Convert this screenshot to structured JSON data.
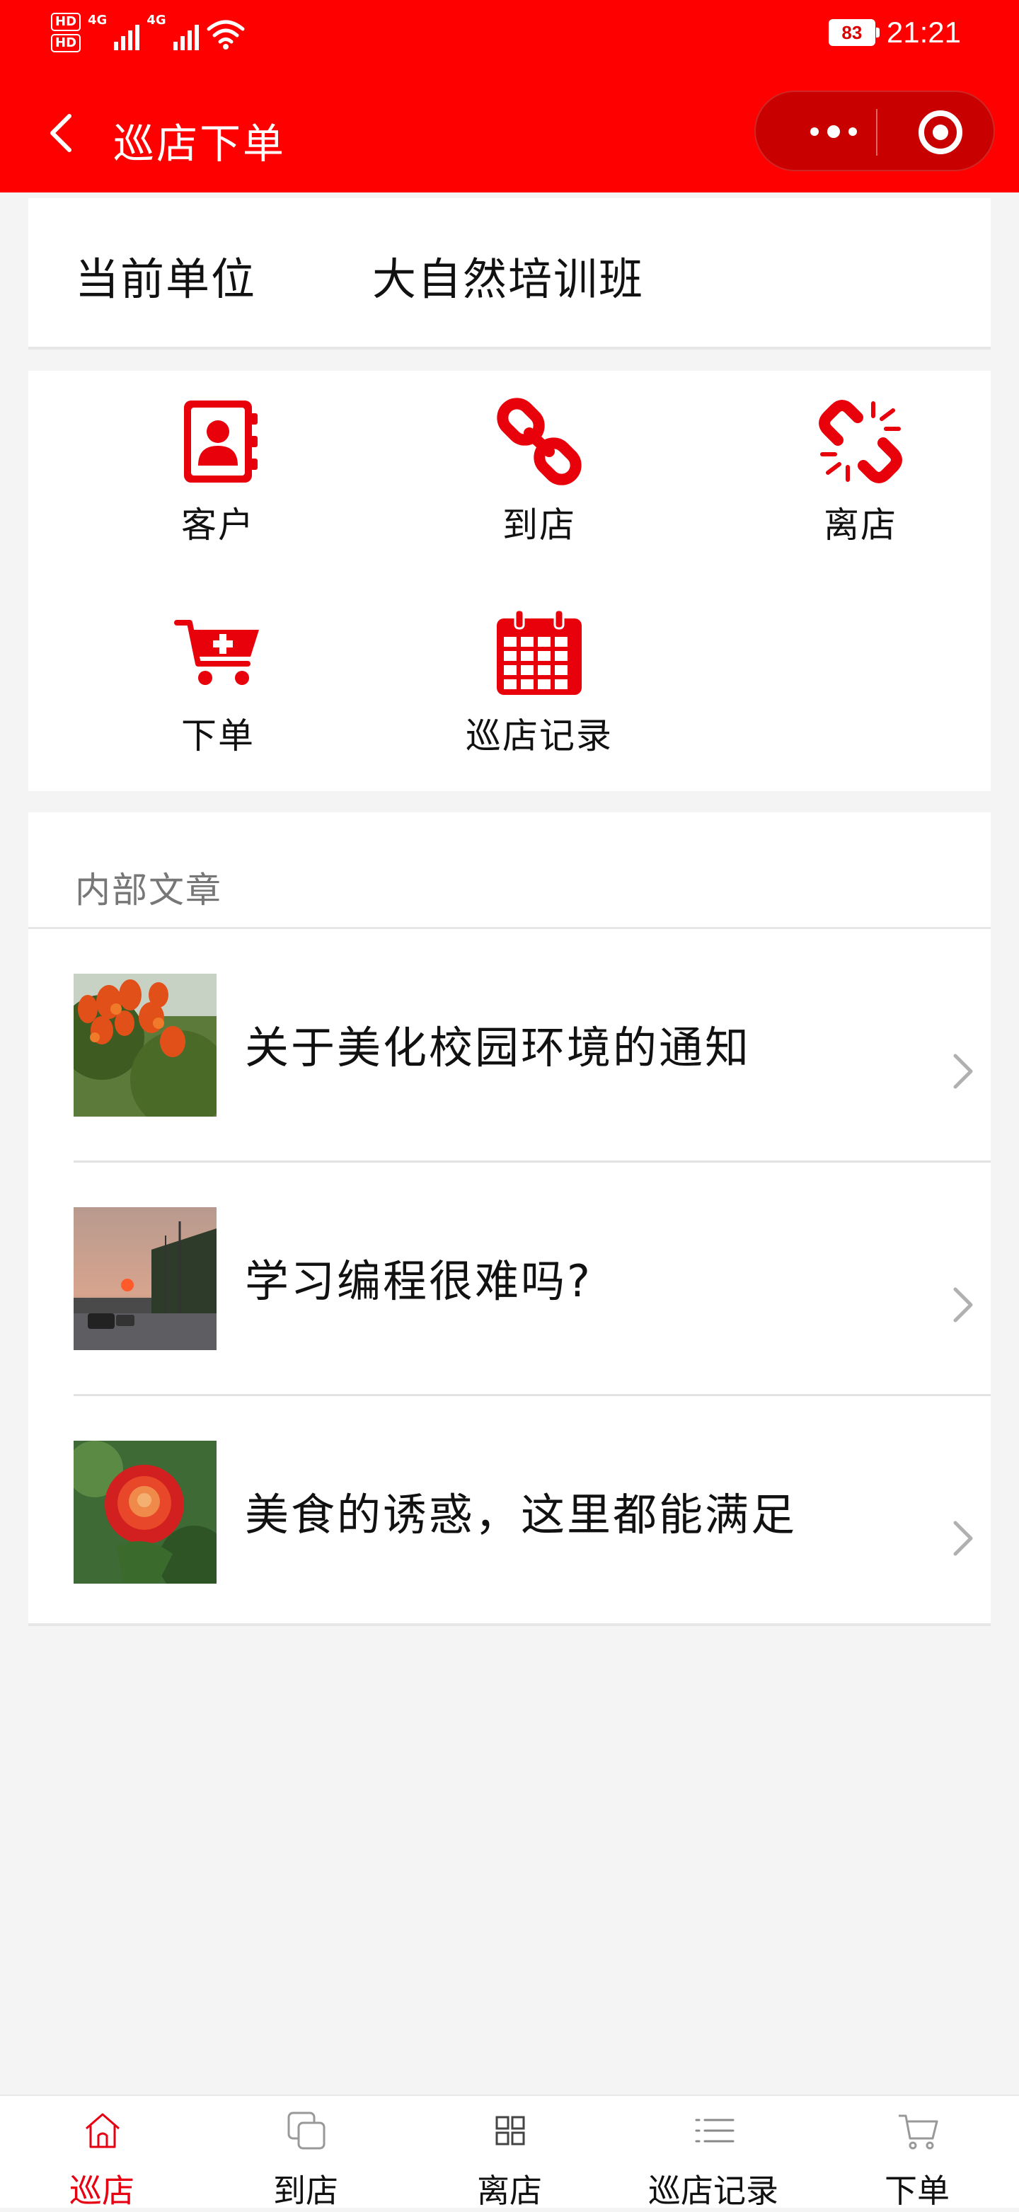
{
  "status_bar": {
    "hd_badges": [
      "HD",
      "HD"
    ],
    "network_1": "4G",
    "network_2": "4G",
    "battery": "83",
    "time": "21:21"
  },
  "header": {
    "title": "巡店下单",
    "back_icon": "chevron-left-icon",
    "menu_icon": "more-dots-icon",
    "close_icon": "target-circle-icon"
  },
  "unit": {
    "label": "当前单位",
    "value": "大自然培训班"
  },
  "functions": [
    {
      "label": "客户",
      "icon": "contacts-book-icon"
    },
    {
      "label": "到店",
      "icon": "link-icon"
    },
    {
      "label": "离店",
      "icon": "broken-link-icon"
    },
    {
      "label": "下单",
      "icon": "cart-plus-icon"
    },
    {
      "label": "巡店记录",
      "icon": "calendar-icon"
    }
  ],
  "articles": {
    "heading": "内部文章",
    "items": [
      {
        "title": "关于美化校园环境的通知",
        "thumb": "orange-flowers-photo"
      },
      {
        "title": "学习编程很难吗?",
        "thumb": "sunset-road-photo"
      },
      {
        "title": "美食的诱惑，这里都能满足",
        "thumb": "red-rose-photo"
      }
    ]
  },
  "tabbar": {
    "items": [
      {
        "label": "巡店",
        "icon": "home-icon",
        "active": true
      },
      {
        "label": "到店",
        "icon": "copy-icon",
        "active": false
      },
      {
        "label": "离店",
        "icon": "grid-icon",
        "active": false
      },
      {
        "label": "巡店记录",
        "icon": "list-icon",
        "active": false
      },
      {
        "label": "下单",
        "icon": "cart-icon",
        "active": false
      }
    ]
  },
  "colors": {
    "brand_red": "#ff0000",
    "icon_red": "#e8000b",
    "active_tab": "#e60012"
  }
}
